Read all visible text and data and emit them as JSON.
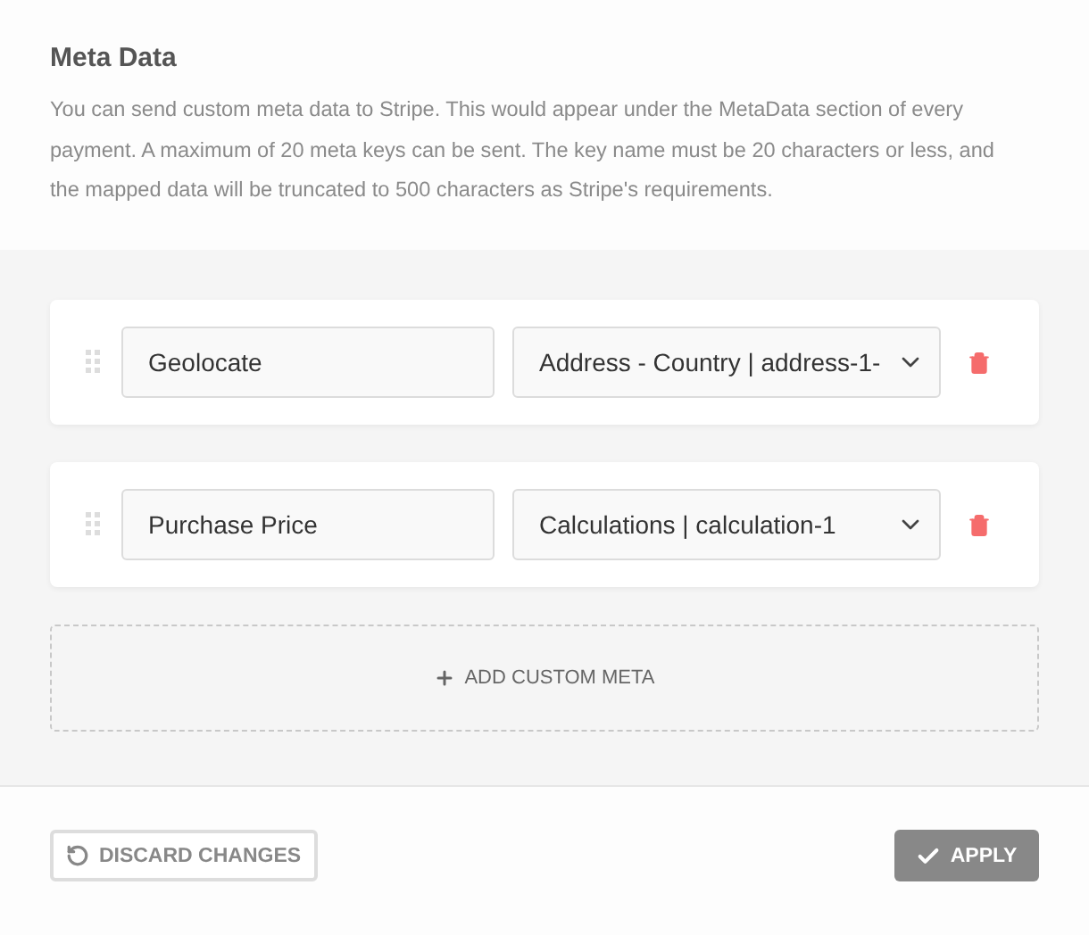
{
  "section": {
    "title": "Meta Data",
    "description": "You can send custom meta data to Stripe. This would appear under the MetaData section of every payment. A maximum of 20 meta keys can be sent. The key name must be 20 characters or less, and the mapped data will be truncated to 500 characters as Stripe's requirements."
  },
  "rows": [
    {
      "key": "Geolocate",
      "value": "Address - Country | address-1-"
    },
    {
      "key": "Purchase Price",
      "value": "Calculations | calculation-1"
    }
  ],
  "add_button": "ADD CUSTOM META",
  "footer": {
    "discard": "DISCARD CHANGES",
    "apply": "APPLY"
  }
}
